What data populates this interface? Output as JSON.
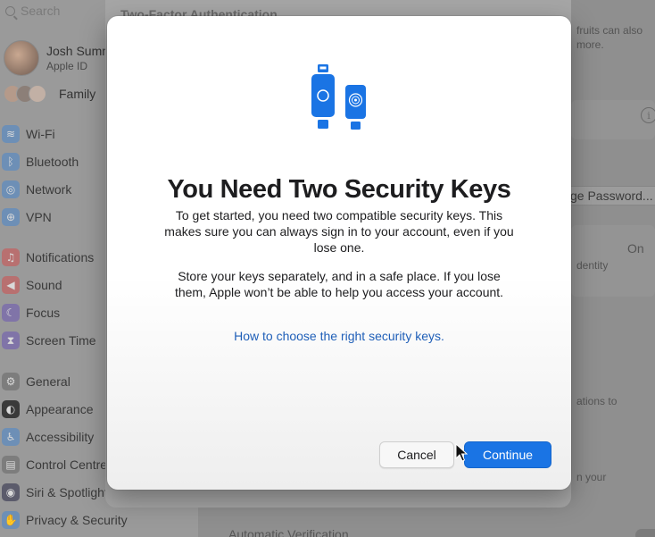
{
  "sidebar": {
    "search_placeholder": "Search",
    "account": {
      "name": "Josh Summ",
      "subtitle": "Apple ID"
    },
    "family_label": "Family",
    "items": [
      {
        "label": "Wi-Fi",
        "icon": "wifi-icon",
        "color": "#6d8fb6"
      },
      {
        "label": "Bluetooth",
        "icon": "bluetooth-icon",
        "color": "#6d8fb6"
      },
      {
        "label": "Network",
        "icon": "globe-icon",
        "color": "#6d8fb6"
      },
      {
        "label": "VPN",
        "icon": "vpn-icon",
        "color": "#6d8fb6"
      },
      {
        "label": "Notifications",
        "icon": "bell-icon",
        "color": "#b87070"
      },
      {
        "label": "Sound",
        "icon": "speaker-icon",
        "color": "#b87070"
      },
      {
        "label": "Focus",
        "icon": "moon-icon",
        "color": "#8074a8"
      },
      {
        "label": "Screen Time",
        "icon": "hourglass-icon",
        "color": "#8074a8"
      },
      {
        "label": "General",
        "icon": "gear-icon",
        "color": "#7d7d7d"
      },
      {
        "label": "Appearance",
        "icon": "appearance-icon",
        "color": "#3a3a3a"
      },
      {
        "label": "Accessibility",
        "icon": "accessibility-icon",
        "color": "#6d8fb6"
      },
      {
        "label": "Control Centre",
        "icon": "control-centre-icon",
        "color": "#7d7d7d"
      },
      {
        "label": "Siri & Spotlight",
        "icon": "siri-icon",
        "color": "#5b5b6b"
      },
      {
        "label": "Privacy & Security",
        "icon": "hand-icon",
        "color": "#6d8fb6"
      }
    ]
  },
  "background": {
    "sheet_title": "Two-Factor Authentication",
    "right_text_1": "fruits can also",
    "right_text_2": "more.",
    "change_password": "ge Password...",
    "on_label": "On",
    "identity_text": "dentity",
    "options_text": "ations to",
    "your_text": "n your",
    "automatic_verification": "Automatic Verification"
  },
  "dialog": {
    "title": "You Need Two Security Keys",
    "paragraph_1": "To get started, you need two compatible security keys. This makes sure you can always sign in to your account, even if you lose one.",
    "paragraph_2": "Store your keys separately, and in a safe place. If you lose them, Apple won’t be able to help you access your account.",
    "link": "How to choose the right security keys.",
    "cancel_label": "Cancel",
    "continue_label": "Continue",
    "accent_color": "#1a74e4",
    "illustration_icon": "security-keys-icon"
  }
}
